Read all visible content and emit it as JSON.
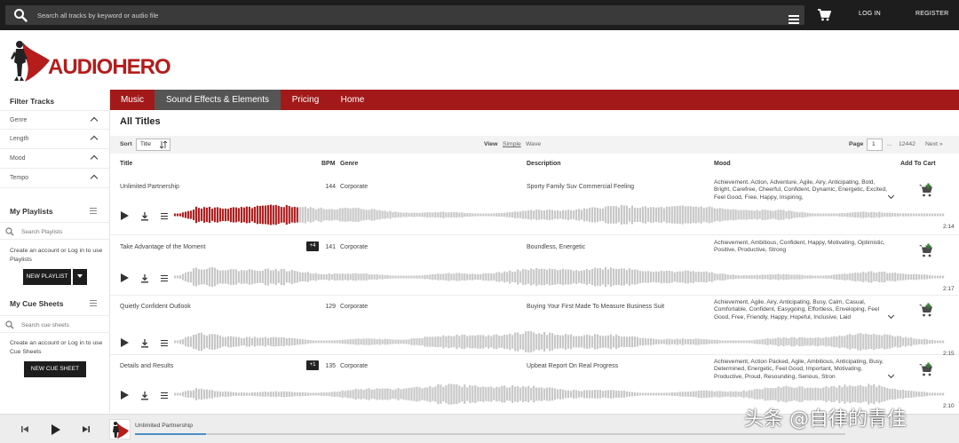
{
  "header": {
    "search_placeholder": "Search all tracks by keyword or audio file",
    "login": "LOG IN",
    "register": "REGISTER"
  },
  "logo": {
    "part1": "AUDIO",
    "part2": "HERO"
  },
  "sidebar": {
    "filter_title": "Filter Tracks",
    "filters": [
      "Genre",
      "Length",
      "Mood",
      "Tempo"
    ],
    "playlists_title": "My Playlists",
    "playlists_search_placeholder": "Search Playlists",
    "playlists_note": "Create an account or Log in to use Playlists",
    "new_playlist": "NEW PLAYLIST",
    "cuesheets_title": "My Cue Sheets",
    "cuesheets_search_placeholder": "Search cue sheets",
    "cuesheets_note": "Create an account or Log in to use Cue Sheets",
    "new_cue_sheet": "NEW CUE SHEET"
  },
  "nav": {
    "tabs": [
      "Music",
      "Sound Effects & Elements",
      "Pricing",
      "Home"
    ],
    "active": 1
  },
  "main": {
    "heading": "All Titles",
    "sort_label": "Sort",
    "sort_value": "Title",
    "view_label": "View",
    "view_simple": "Simple",
    "view_wave": "Wave",
    "page_label": "Page",
    "page_value": "1",
    "page_ellipsis": "...",
    "page_total": "12442",
    "next": "Next »"
  },
  "columns": {
    "title": "Title",
    "bpm": "BPM",
    "genre": "Genre",
    "description": "Description",
    "mood": "Mood",
    "cart": "Add To Cart"
  },
  "tracks": [
    {
      "title": "Unlimited Partnership",
      "badge": "",
      "bpm": "144",
      "genre": "Corporate",
      "description": "Sporty Family Suv Commercial Feeling",
      "mood": "Achievement, Action, Adventure, Agile, Airy, Anticipating, Bold, Bright, Carefree, Cheerful, Confident, Dynamic, Energetic, Excited, Feel Good, Free, Happy, Inspiring,",
      "duration": "2:14",
      "played": 0.16
    },
    {
      "title": "Take Advantage of the Moment",
      "badge": "+4",
      "bpm": "141",
      "genre": "Corporate",
      "description": "Boundless, Energetic",
      "mood": "Achievement, Ambitious, Confident, Happy, Motivating, Optimistic, Positive, Productive, Strong",
      "duration": "2:17",
      "played": 0
    },
    {
      "title": "Quietly Confident Outlook",
      "badge": "",
      "bpm": "129",
      "genre": "Corporate",
      "description": "Buying Your First Made To Measure Business Suit",
      "mood": "Achievement, Agile, Airy, Anticipating, Busy, Calm, Casual, Comfortable, Confident, Easygoing, Effortless, Enveloping, Feel Good, Free, Friendly, Happy, Hopeful, Inclusive, Laid",
      "duration": "2:15",
      "played": 0
    },
    {
      "title": "Details and Results",
      "badge": "+1",
      "bpm": "135",
      "genre": "Corporate",
      "description": "Upbeat Report On Real Progress",
      "mood": "Achievement, Action Packed, Agile, Ambitious, Anticipating, Busy, Determined, Energetic, Feel Good, Important, Motivating, Productive, Proud, Resounding, Serious, Stron",
      "duration": "2:10",
      "played": 0
    }
  ],
  "player": {
    "title": "Unlimited Partnership",
    "progress": 0.1
  },
  "colors": {
    "brand_red": "#a31919",
    "active_tab": "#555555",
    "played_wave": "#b02020",
    "wave": "#c8c8c8",
    "cart_green": "#3a7d3a"
  },
  "watermark": "头条 @自律的青佳"
}
